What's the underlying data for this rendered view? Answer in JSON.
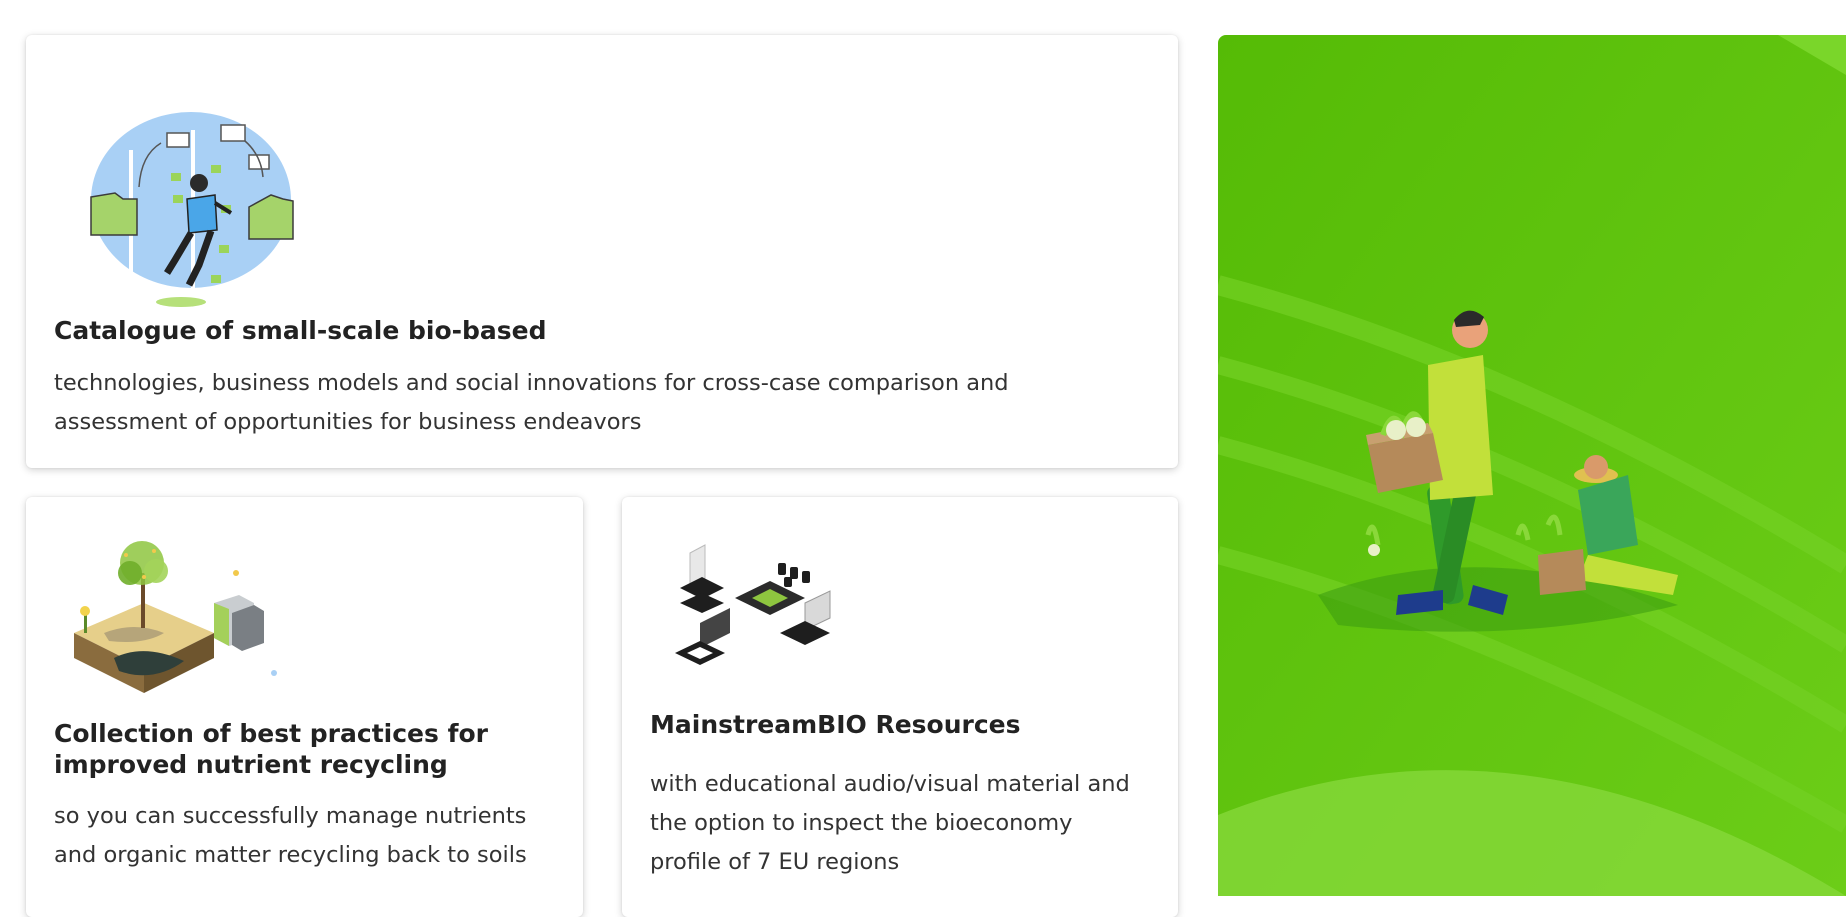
{
  "cards": {
    "catalogue": {
      "title": "Catalogue of small-scale bio-based",
      "description": "technologies, business models and social innovations for cross-case comparison and assessment of opportunities for business endeavors",
      "icon": "person-with-documents-illustration"
    },
    "collection": {
      "title": "Collection of best practices for improved nutrient recycling",
      "description": "so you can successfully manage nutrients and organic matter recycling back to soils",
      "icon": "soil-recycling-illustration"
    },
    "resources": {
      "title": "MainstreamBIO Resources",
      "description": "with educational audio/visual material and the option to inspect the bioeconomy profile of 7 EU regions",
      "icon": "isometric-tech-illustration"
    }
  },
  "hero": {
    "icon": "farmers-harvesting-illustration",
    "colors": {
      "primary": "#5cc00e",
      "light": "#8ad83a",
      "dark": "#3a8c0c"
    }
  }
}
